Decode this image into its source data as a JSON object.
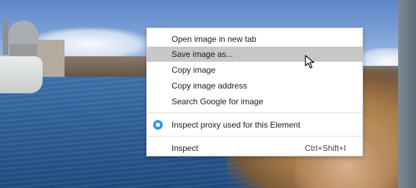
{
  "context_menu": {
    "items": [
      {
        "label": "Open image in new tab"
      },
      {
        "label": "Save image as..."
      },
      {
        "label": "Copy image"
      },
      {
        "label": "Copy image address"
      },
      {
        "label": "Search Google for image"
      },
      {
        "label": "Inspect proxy used for this Element",
        "icon": "radio-icon"
      },
      {
        "label": "Inspect",
        "shortcut": "Ctrl+Shift+I"
      }
    ],
    "hovered_item": "Save image as...",
    "accent_color": "#2d9be8"
  },
  "cursor": {
    "icon": "mouse-pointer-icon"
  }
}
